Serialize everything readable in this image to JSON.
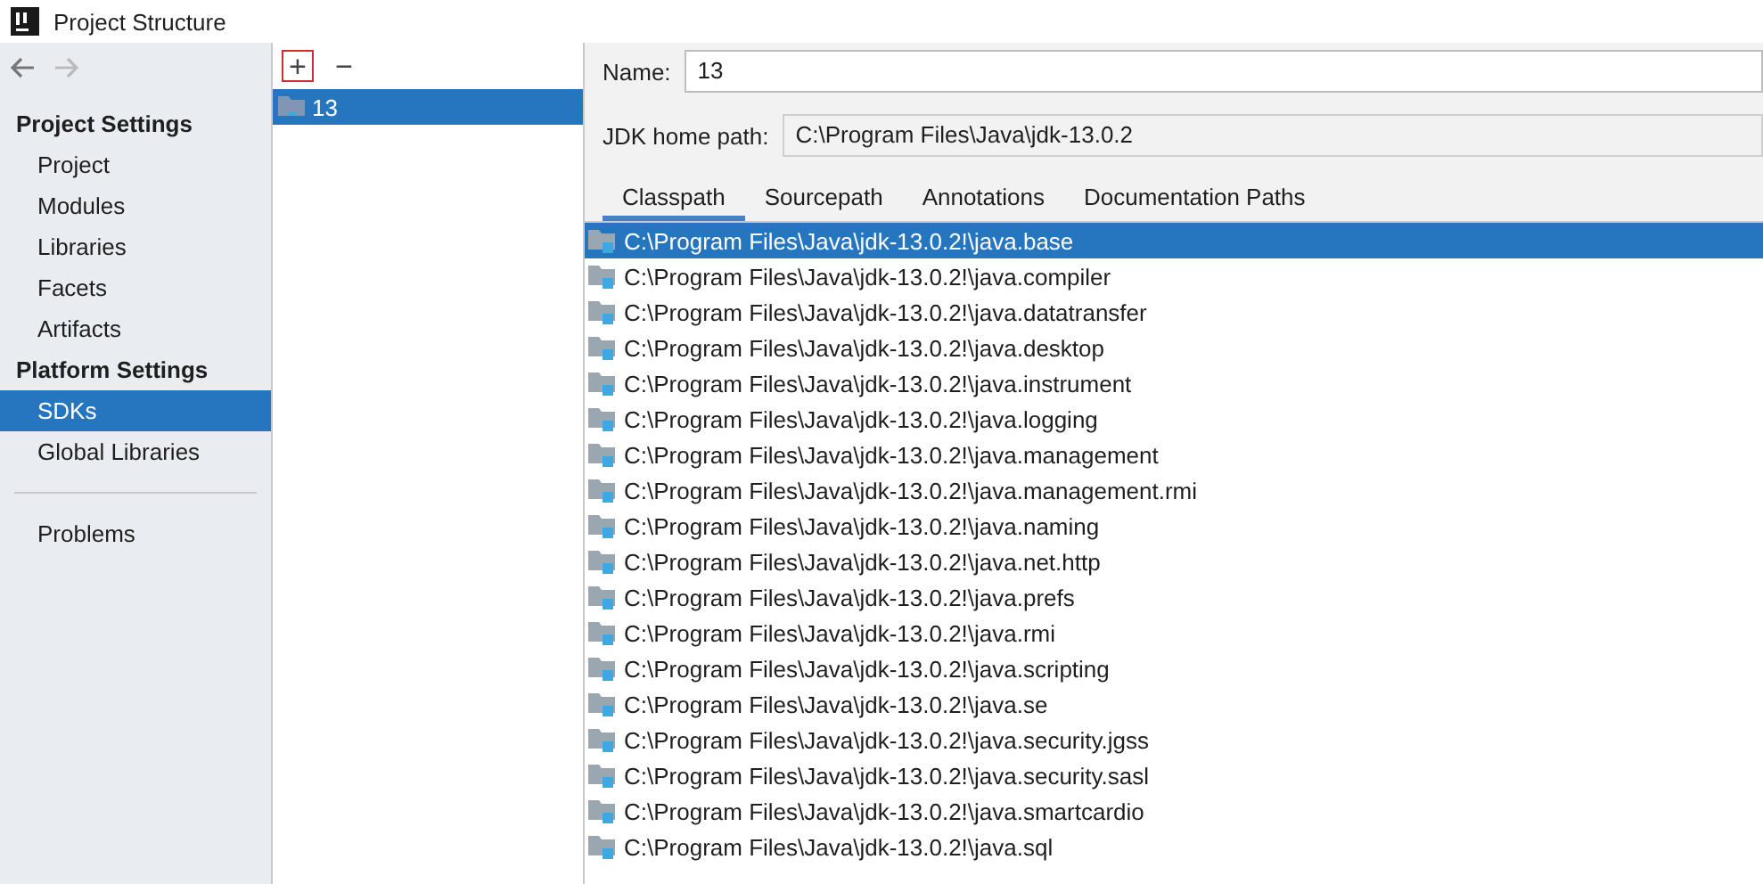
{
  "window": {
    "title": "Project Structure"
  },
  "sidebar": {
    "sections": [
      {
        "heading": "Project Settings",
        "items": [
          {
            "label": "Project",
            "selected": false
          },
          {
            "label": "Modules",
            "selected": false
          },
          {
            "label": "Libraries",
            "selected": false
          },
          {
            "label": "Facets",
            "selected": false
          },
          {
            "label": "Artifacts",
            "selected": false
          }
        ]
      },
      {
        "heading": "Platform Settings",
        "items": [
          {
            "label": "SDKs",
            "selected": true
          },
          {
            "label": "Global Libraries",
            "selected": false
          }
        ]
      }
    ],
    "footer_items": [
      {
        "label": "Problems",
        "selected": false
      }
    ]
  },
  "sdk_list": {
    "toolbar": [
      "+",
      "−"
    ],
    "items": [
      {
        "label": "13",
        "selected": true
      }
    ]
  },
  "details": {
    "name_label": "Name:",
    "name_value": "13",
    "home_label": "JDK home path:",
    "home_value": "C:\\Program Files\\Java\\jdk-13.0.2",
    "tabs": [
      {
        "label": "Classpath",
        "selected": true
      },
      {
        "label": "Sourcepath",
        "selected": false
      },
      {
        "label": "Annotations",
        "selected": false
      },
      {
        "label": "Documentation Paths",
        "selected": false
      }
    ],
    "classpath": [
      {
        "path": "C:\\Program Files\\Java\\jdk-13.0.2!\\java.base",
        "selected": true
      },
      {
        "path": "C:\\Program Files\\Java\\jdk-13.0.2!\\java.compiler",
        "selected": false
      },
      {
        "path": "C:\\Program Files\\Java\\jdk-13.0.2!\\java.datatransfer",
        "selected": false
      },
      {
        "path": "C:\\Program Files\\Java\\jdk-13.0.2!\\java.desktop",
        "selected": false
      },
      {
        "path": "C:\\Program Files\\Java\\jdk-13.0.2!\\java.instrument",
        "selected": false
      },
      {
        "path": "C:\\Program Files\\Java\\jdk-13.0.2!\\java.logging",
        "selected": false
      },
      {
        "path": "C:\\Program Files\\Java\\jdk-13.0.2!\\java.management",
        "selected": false
      },
      {
        "path": "C:\\Program Files\\Java\\jdk-13.0.2!\\java.management.rmi",
        "selected": false
      },
      {
        "path": "C:\\Program Files\\Java\\jdk-13.0.2!\\java.naming",
        "selected": false
      },
      {
        "path": "C:\\Program Files\\Java\\jdk-13.0.2!\\java.net.http",
        "selected": false
      },
      {
        "path": "C:\\Program Files\\Java\\jdk-13.0.2!\\java.prefs",
        "selected": false
      },
      {
        "path": "C:\\Program Files\\Java\\jdk-13.0.2!\\java.rmi",
        "selected": false
      },
      {
        "path": "C:\\Program Files\\Java\\jdk-13.0.2!\\java.scripting",
        "selected": false
      },
      {
        "path": "C:\\Program Files\\Java\\jdk-13.0.2!\\java.se",
        "selected": false
      },
      {
        "path": "C:\\Program Files\\Java\\jdk-13.0.2!\\java.security.jgss",
        "selected": false
      },
      {
        "path": "C:\\Program Files\\Java\\jdk-13.0.2!\\java.security.sasl",
        "selected": false
      },
      {
        "path": "C:\\Program Files\\Java\\jdk-13.0.2!\\java.smartcardio",
        "selected": false
      },
      {
        "path": "C:\\Program Files\\Java\\jdk-13.0.2!\\java.sql",
        "selected": false
      }
    ]
  }
}
